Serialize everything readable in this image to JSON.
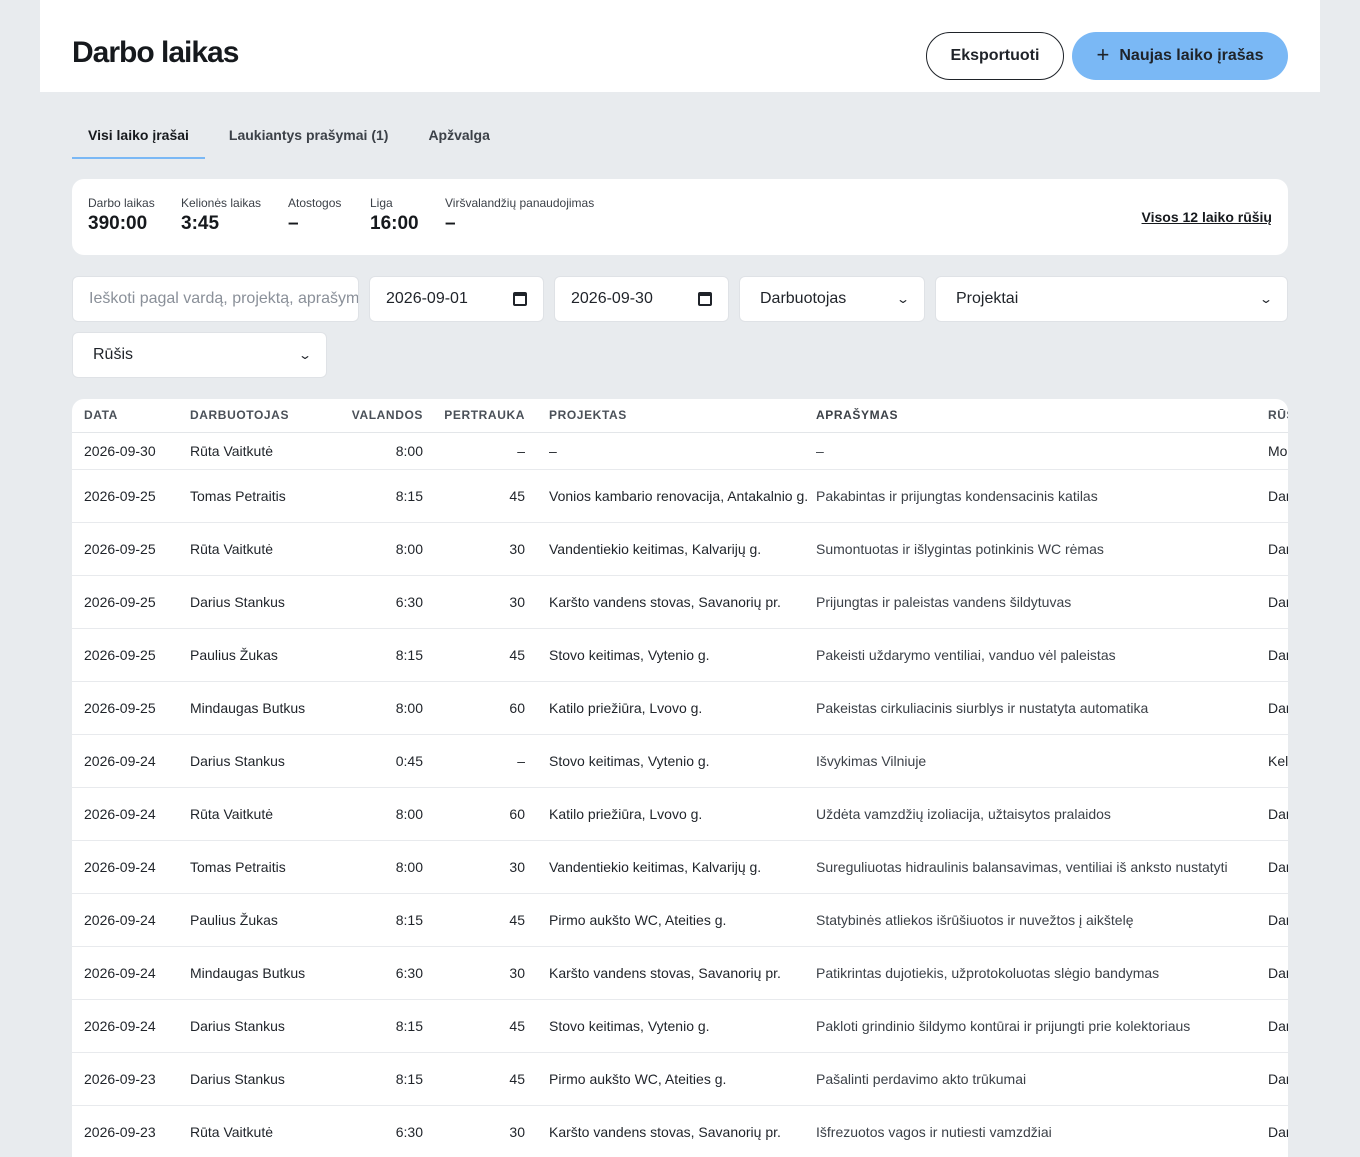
{
  "header": {
    "title": "Darbo laikas",
    "export_label": "Eksportuoti",
    "new_entry_label": "Naujas laiko įrašas"
  },
  "tabs": [
    {
      "label": "Visi laiko įrašai",
      "active": true
    },
    {
      "label": "Laukiantys prašymai (1)",
      "active": false
    },
    {
      "label": "Apžvalga",
      "active": false
    }
  ],
  "summary": {
    "stats": [
      {
        "label": "Darbo laikas",
        "value": "390:00"
      },
      {
        "label": "Kelionės laikas",
        "value": "3:45"
      },
      {
        "label": "Atostogos",
        "value": "–"
      },
      {
        "label": "Liga",
        "value": "16:00"
      },
      {
        "label": "Viršvalandžių panaudojimas",
        "value": "–"
      }
    ],
    "all_types_link": "Visos 12 laiko rūšių"
  },
  "filters": {
    "search_placeholder": "Ieškoti pagal vardą, projektą, aprašymą",
    "date_from": "2026-09-01",
    "date_to": "2026-09-30",
    "employee": "Darbuotojas",
    "projects": "Projektai",
    "type": "Rūšis"
  },
  "table": {
    "columns": [
      "DATA",
      "DARBUOTOJAS",
      "VALANDOS",
      "PERTRAUKA",
      "PROJEKTAS",
      "APRAŠYMAS",
      "RŪŠIS"
    ],
    "rows": [
      [
        "2026-09-30",
        "Rūta Vaitkutė",
        "8:00",
        "–",
        "–",
        "–",
        "Mokymai"
      ],
      [
        "2026-09-25",
        "Tomas Petraitis",
        "8:15",
        "45",
        "Vonios kambario renovacija, Antakalnio g.",
        "Pakabintas ir prijungtas kondensacinis katilas",
        "Darbo laikas"
      ],
      [
        "2026-09-25",
        "Rūta Vaitkutė",
        "8:00",
        "30",
        "Vandentiekio keitimas, Kalvarijų g.",
        "Sumontuotas ir išlygintas potinkinis WC rėmas",
        "Darbo laikas"
      ],
      [
        "2026-09-25",
        "Darius Stankus",
        "6:30",
        "30",
        "Karšto vandens stovas, Savanorių pr.",
        "Prijungtas ir paleistas vandens šildytuvas",
        "Darbo laikas"
      ],
      [
        "2026-09-25",
        "Paulius Žukas",
        "8:15",
        "45",
        "Stovo keitimas, Vytenio g.",
        "Pakeisti uždarymo ventiliai, vanduo vėl paleistas",
        "Darbo laikas"
      ],
      [
        "2026-09-25",
        "Mindaugas Butkus",
        "8:00",
        "60",
        "Katilo priežiūra, Lvovo g.",
        "Pakeistas cirkuliacinis siurblys ir nustatyta automatika",
        "Darbo laikas"
      ],
      [
        "2026-09-24",
        "Darius Stankus",
        "0:45",
        "–",
        "Stovo keitimas, Vytenio g.",
        "Išvykimas Vilniuje",
        "Kelionės laikas"
      ],
      [
        "2026-09-24",
        "Rūta Vaitkutė",
        "8:00",
        "60",
        "Katilo priežiūra, Lvovo g.",
        "Uždėta vamzdžių izoliacija, užtaisytos pralaidos",
        "Darbo laikas"
      ],
      [
        "2026-09-24",
        "Tomas Petraitis",
        "8:00",
        "30",
        "Vandentiekio keitimas, Kalvarijų g.",
        "Sureguliuotas hidraulinis balansavimas, ventiliai iš anksto nustatyti",
        "Darbo laikas"
      ],
      [
        "2026-09-24",
        "Paulius Žukas",
        "8:15",
        "45",
        "Pirmo aukšto WC, Ateities g.",
        "Statybinės atliekos išrūšiuotos ir nuvežtos į aikštelę",
        "Darbo laikas"
      ],
      [
        "2026-09-24",
        "Mindaugas Butkus",
        "6:30",
        "30",
        "Karšto vandens stovas, Savanorių pr.",
        "Patikrintas dujotiekis, užprotokoluotas slėgio bandymas",
        "Darbo laikas"
      ],
      [
        "2026-09-24",
        "Darius Stankus",
        "8:15",
        "45",
        "Stovo keitimas, Vytenio g.",
        "Pakloti grindinio šildymo kontūrai ir prijungti prie kolektoriaus",
        "Darbo laikas"
      ],
      [
        "2026-09-23",
        "Darius Stankus",
        "8:15",
        "45",
        "Pirmo aukšto WC, Ateities g.",
        "Pašalinti perdavimo akto trūkumai",
        "Darbo laikas"
      ],
      [
        "2026-09-23",
        "Rūta Vaitkutė",
        "6:30",
        "30",
        "Karšto vandens stovas, Savanorių pr.",
        "Išfrezuotos vagos ir nutiesti vamzdžiai",
        "Darbo laikas"
      ]
    ]
  },
  "colors": {
    "accent": "#7ab8f5",
    "background": "#e8ebee"
  },
  "icons": {
    "new_entry": "plus-icon",
    "date": "calendar-icon",
    "select": "chevron-down-icon"
  }
}
